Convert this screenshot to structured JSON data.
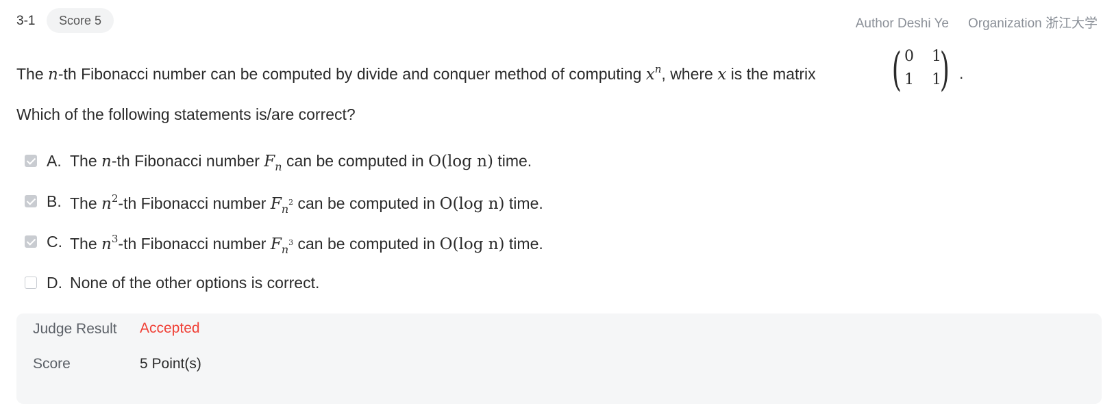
{
  "header": {
    "question_id": "3-1",
    "score_pill": "Score 5",
    "author": "Author Deshi Ye",
    "organization": "Organization 浙江大学"
  },
  "stem": {
    "part1": "The ",
    "var_n": "n",
    "part2": "-th Fibonacci number can be computed by divide and conquer method of computing ",
    "var_x": "x",
    "sup_n": "n",
    "part3": ", where ",
    "var_x2": "x",
    "part4": " is the matrix ",
    "matrix": {
      "a11": "0",
      "a12": "1",
      "a21": "1",
      "a22": "1"
    },
    "end": "."
  },
  "prompt": "Which of the following statements is/are correct?",
  "options": [
    {
      "letter": "A.",
      "checked": true,
      "pre": "The ",
      "power": "n",
      "exp": "",
      "mid": "-th Fibonacci number ",
      "F": "F",
      "sub": "n",
      "subexp": "",
      "post1": " can be computed in ",
      "complexity": "O(log n)",
      "post2": " time."
    },
    {
      "letter": "B.",
      "checked": true,
      "pre": "The ",
      "power": "n",
      "exp": "2",
      "mid": "-th Fibonacci number ",
      "F": "F",
      "sub": "n",
      "subexp": "2",
      "post1": " can be computed in ",
      "complexity": "O(log n)",
      "post2": " time."
    },
    {
      "letter": "C.",
      "checked": true,
      "pre": "The ",
      "power": "n",
      "exp": "3",
      "mid": "-th Fibonacci number ",
      "F": "F",
      "sub": "n",
      "subexp": "3",
      "post1": " can be computed in ",
      "complexity": "O(log n)",
      "post2": " time."
    },
    {
      "letter": "D.",
      "checked": false,
      "text": "None of the other options is correct."
    }
  ],
  "result": {
    "judge_label": "Judge Result",
    "judge_value": "Accepted",
    "score_label": "Score",
    "score_value": "5 Point(s)"
  },
  "colors": {
    "accepted": "#f04137",
    "checkbox_checked": "#c9ccd1",
    "panel_bg": "#f5f6f7"
  }
}
